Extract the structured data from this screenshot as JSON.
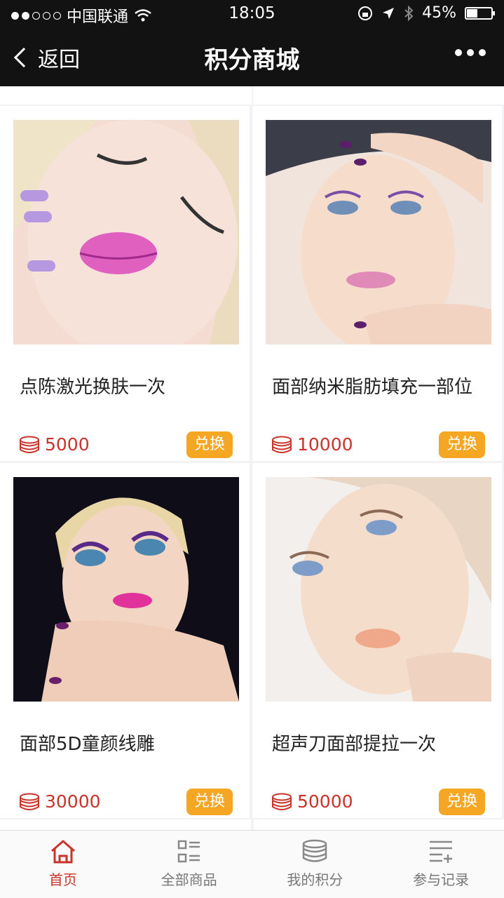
{
  "status": {
    "carrier": "中国联通",
    "time": "18:05",
    "battery": "45%",
    "battery_level": 0.45
  },
  "nav": {
    "back": "返回",
    "title": "积分商城"
  },
  "products": [
    {
      "name": "点陈激光换肤一次",
      "points": "5000",
      "button": "兑换"
    },
    {
      "name": "面部纳米脂肪填充一部位",
      "points": "10000",
      "button": "兑换"
    },
    {
      "name": "面部5D童颜线雕",
      "points": "30000",
      "button": "兑换"
    },
    {
      "name": "超声刀面部提拉一次",
      "points": "50000",
      "button": "兑换"
    }
  ],
  "tabs": [
    {
      "label": "首页",
      "icon": "home-icon"
    },
    {
      "label": "全部商品",
      "icon": "list-grid-icon"
    },
    {
      "label": "我的积分",
      "icon": "coins-stack-icon"
    },
    {
      "label": "参与记录",
      "icon": "records-list-icon"
    }
  ],
  "colors": {
    "accent": "#c9332a",
    "button": "#f5a623",
    "navbar": "#121212"
  }
}
